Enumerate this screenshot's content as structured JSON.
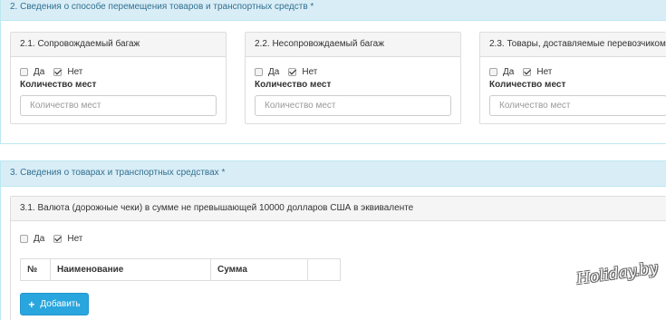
{
  "section2": {
    "title": "2. Сведения о способе перемещения товаров и транспортных средств *",
    "panels": [
      {
        "title": "2.1. Сопровождаемый багаж",
        "yes_label": "Да",
        "no_label": "Нет",
        "yes_checked": false,
        "no_checked": true,
        "count_label": "Количество мест",
        "count_placeholder": "Количество мест"
      },
      {
        "title": "2.2. Несопровождаемый багаж",
        "yes_label": "Да",
        "no_label": "Нет",
        "yes_checked": false,
        "no_checked": true,
        "count_label": "Количество мест",
        "count_placeholder": "Количество мест"
      },
      {
        "title": "2.3. Товары, доставляемые перевозчиком",
        "yes_label": "Да",
        "no_label": "Нет",
        "yes_checked": false,
        "no_checked": true,
        "count_label": "Количество мест",
        "count_placeholder": "Количество мест"
      }
    ]
  },
  "section3": {
    "title": "3. Сведения о товарах и транспортных средствах *",
    "panel": {
      "title": "3.1. Валюта (дорожные чеки) в сумме не превышающей 10000 долларов США в эквиваленте",
      "yes_label": "Да",
      "no_label": "Нет",
      "yes_checked": false,
      "no_checked": true,
      "table_headers": [
        "№",
        "Наименование",
        "Сумма",
        ""
      ],
      "add_button_label": "Добавить"
    }
  },
  "watermark": "Holiday.by",
  "colors": {
    "info_heading_bg": "#d9edf7",
    "info_border": "#bce8f1",
    "info_text": "#31708f",
    "button_primary": "#2aa6de"
  }
}
